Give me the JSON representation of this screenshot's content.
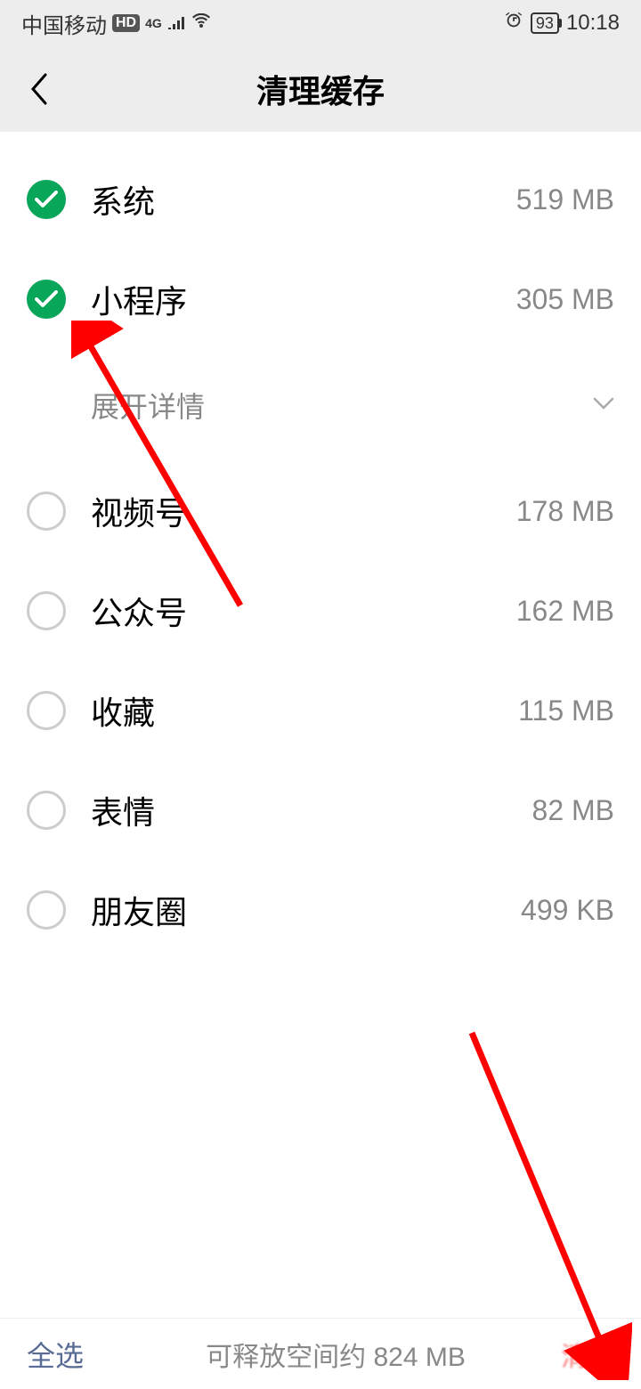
{
  "status": {
    "carrier": "中国移动",
    "hd": "HD",
    "network": "4G",
    "battery": "93",
    "time": "10:18"
  },
  "header": {
    "title": "清理缓存"
  },
  "items": [
    {
      "label": "系统",
      "size": "519 MB",
      "checked": true
    },
    {
      "label": "小程序",
      "size": "305 MB",
      "checked": true
    },
    {
      "label": "视频号",
      "size": "178 MB",
      "checked": false
    },
    {
      "label": "公众号",
      "size": "162 MB",
      "checked": false
    },
    {
      "label": "收藏",
      "size": "115 MB",
      "checked": false
    },
    {
      "label": "表情",
      "size": "82 MB",
      "checked": false
    },
    {
      "label": "朋友圈",
      "size": "499 KB",
      "checked": false
    }
  ],
  "expand": {
    "label": "展开详情"
  },
  "footer": {
    "select_all": "全选",
    "freeable": "可释放空间约 824 MB",
    "clear": "清理"
  }
}
